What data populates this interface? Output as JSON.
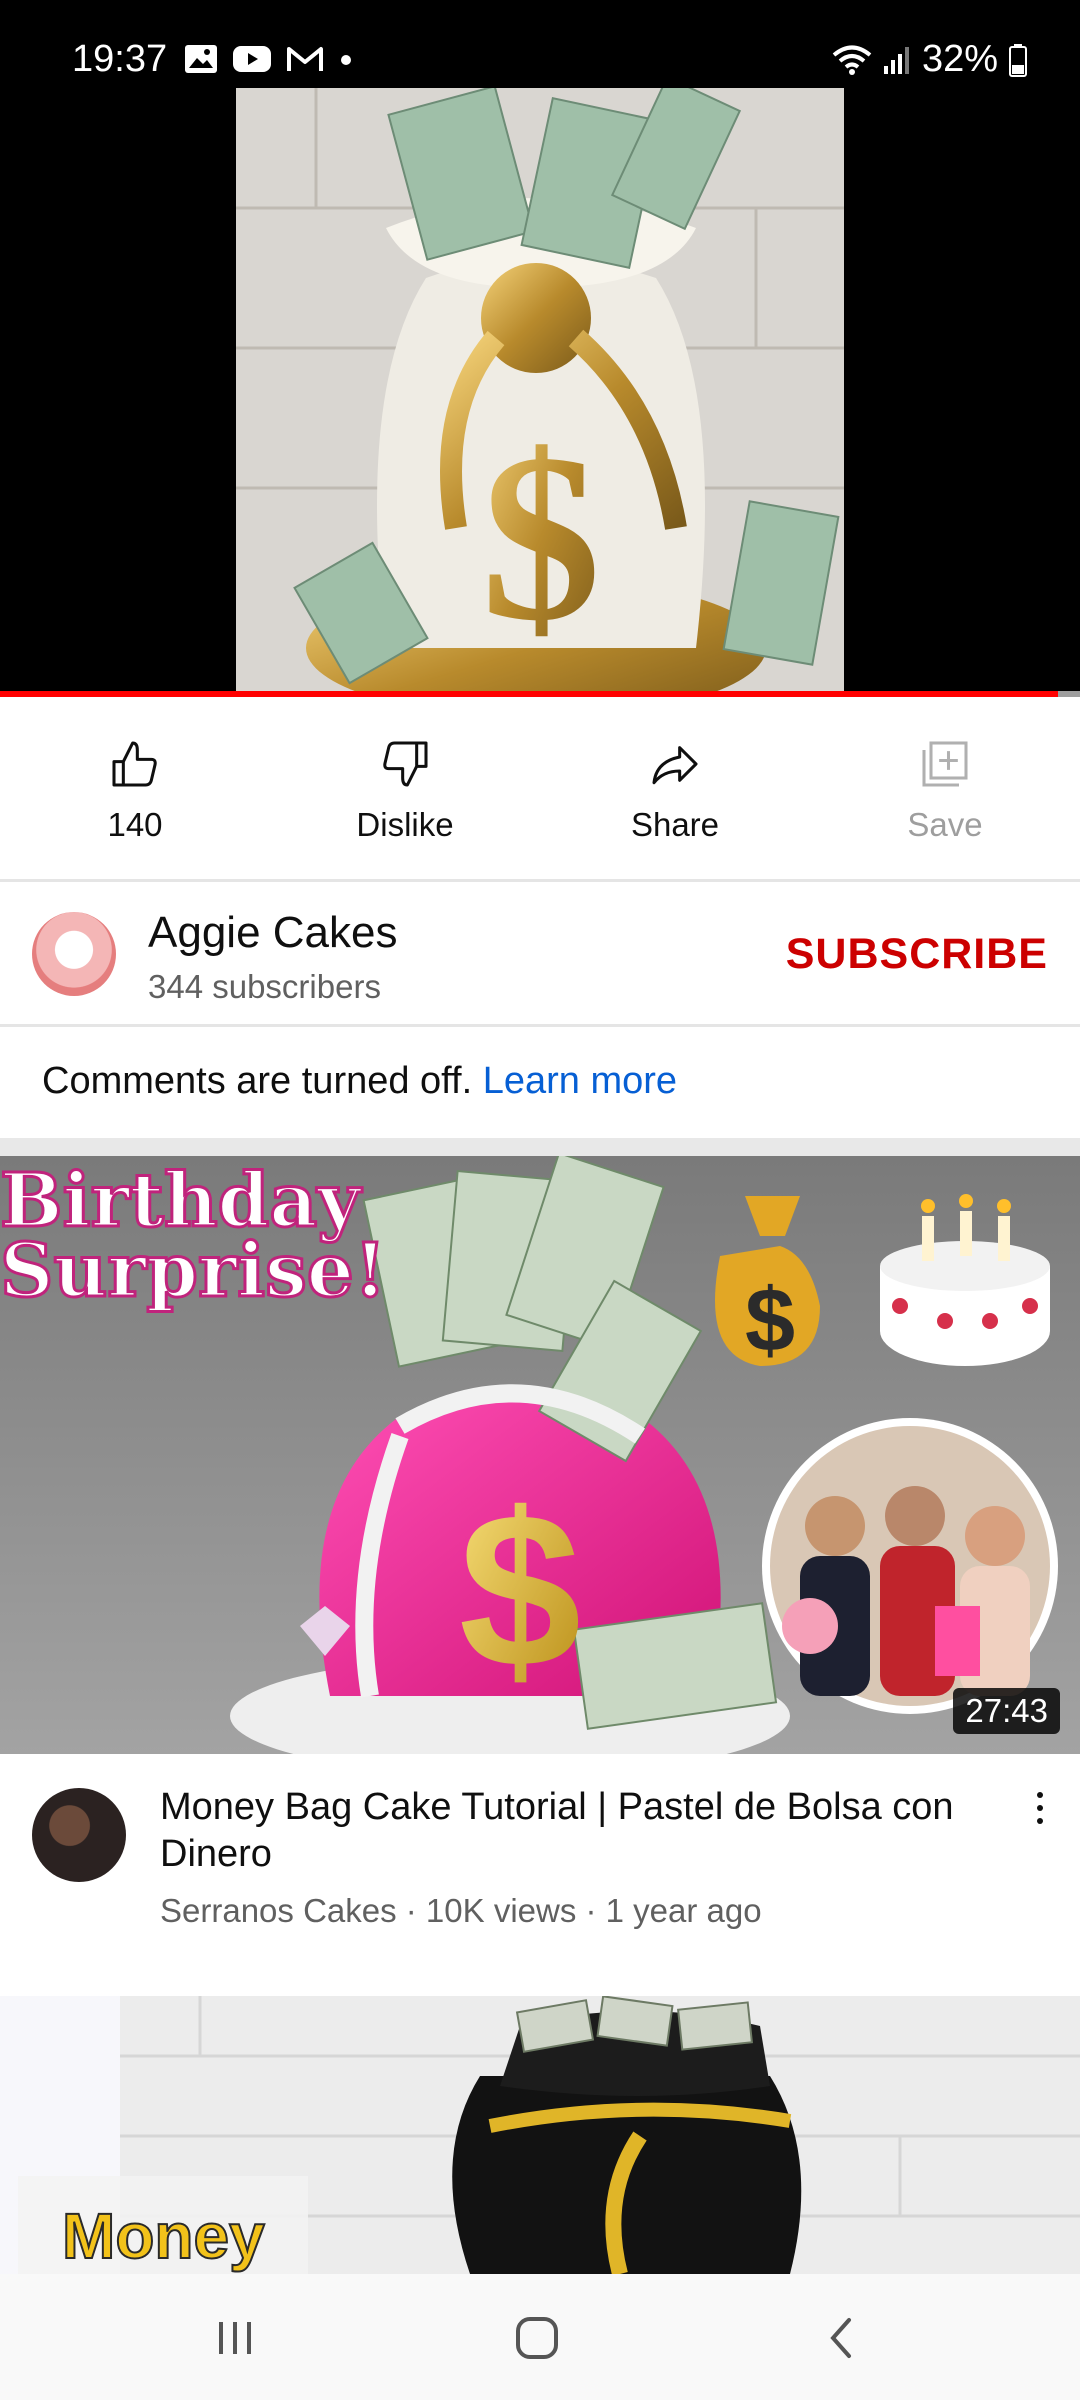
{
  "status_bar": {
    "time": "19:37",
    "notification_icons": [
      "gallery-icon",
      "youtube-icon",
      "gmail-icon",
      "dot-icon"
    ],
    "battery": "32%",
    "system_icons": [
      "wifi-icon",
      "signal-icon",
      "battery-icon"
    ]
  },
  "player": {
    "progress_fraction": 0.98,
    "progress_color": "#ff0000"
  },
  "actions": {
    "like_count": "140",
    "dislike_label": "Dislike",
    "share_label": "Share",
    "save_label": "Save"
  },
  "channel": {
    "name": "Aggie Cakes",
    "subscribers": "344 subscribers",
    "subscribe_label": "SUBSCRIBE",
    "subscribe_color": "#cc0000"
  },
  "comments": {
    "text": "Comments are turned off.",
    "link": "Learn more",
    "link_color": "#065fd4"
  },
  "recommended": [
    {
      "thumbnail_text_line1": "Birthday",
      "thumbnail_text_line2": "Surprise!",
      "duration": "27:43",
      "title": "Money Bag Cake Tutorial | Pastel de Bolsa con Dinero",
      "subtitle": "Serranos Cakes · 10K views · 1 year ago"
    },
    {
      "thumbnail_text": "Money"
    }
  ],
  "navbar": {
    "buttons": [
      "recent-apps-icon",
      "home-icon",
      "back-icon"
    ]
  }
}
